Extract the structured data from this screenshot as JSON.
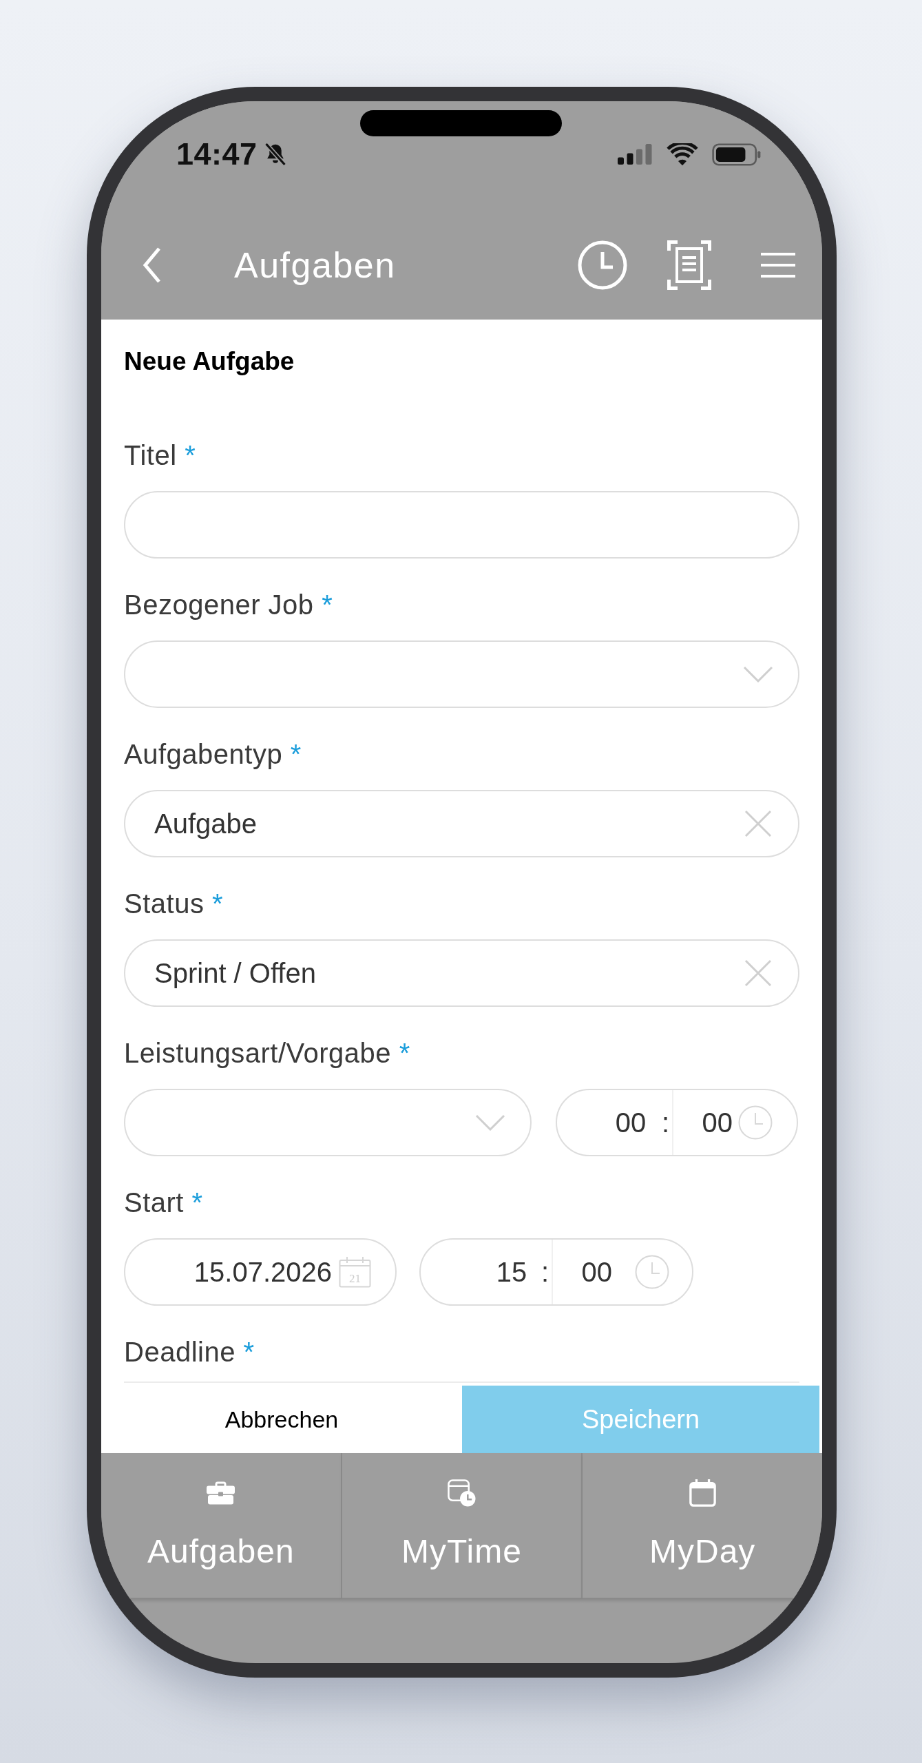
{
  "status_bar": {
    "time": "14:47"
  },
  "header": {
    "title": "Aufgaben"
  },
  "form": {
    "title": "Neue Aufgabe",
    "fields": [
      {
        "kind": "text",
        "label": "Titel",
        "required_mark": "*"
      },
      {
        "kind": "select",
        "label": "Bezogener Job",
        "required_mark": "*"
      },
      {
        "kind": "clearable",
        "label": "Aufgabentyp",
        "required_mark": "*",
        "value": "Aufgabe"
      },
      {
        "kind": "clearable",
        "label": "Status",
        "required_mark": "*",
        "value": "Sprint / Offen"
      },
      {
        "kind": "duration",
        "label": "Leistungsart/Vorgabe",
        "required_mark": "*",
        "time": {
          "hours": "00",
          "separator": ":",
          "minutes": "00"
        }
      },
      {
        "kind": "datetime",
        "label": "Start",
        "required_mark": "*",
        "date": "15.07.2026",
        "date_icon_day": "21",
        "time": {
          "hours": "15",
          "separator": ":",
          "minutes": "00"
        }
      },
      {
        "kind": "label_only",
        "label": "Deadline",
        "required_mark": "*"
      }
    ]
  },
  "actions": {
    "cancel": "Abbrechen",
    "save": "Speichern"
  },
  "tab_bar": [
    {
      "label": "Aufgaben"
    },
    {
      "label": "MyTime"
    },
    {
      "label": "MyDay"
    }
  ]
}
